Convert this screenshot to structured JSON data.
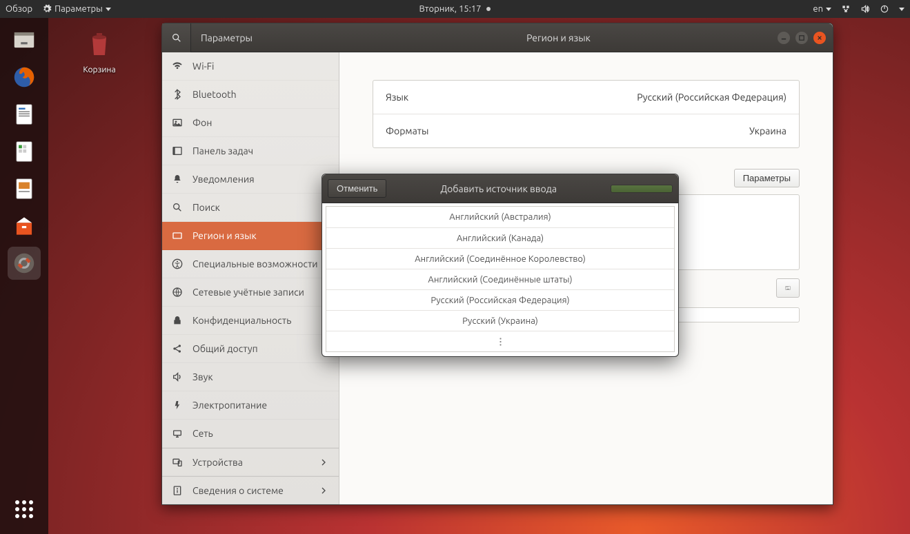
{
  "topbar": {
    "overview": "Обзор",
    "app_menu": "Параметры",
    "datetime": "Вторник, 15:17",
    "lang": "en"
  },
  "desktop": {
    "trash_label": "Корзина"
  },
  "dock": {
    "items": [
      "files",
      "firefox",
      "writer",
      "calc",
      "impress",
      "software",
      "settings"
    ]
  },
  "window": {
    "sidebar_title": "Параметры",
    "main_title": "Регион и язык"
  },
  "sidebar": {
    "items": [
      {
        "icon": "wifi",
        "label": "Wi-Fi"
      },
      {
        "icon": "bluetooth",
        "label": "Bluetooth"
      },
      {
        "icon": "background",
        "label": "Фон"
      },
      {
        "icon": "dock",
        "label": "Панель задач"
      },
      {
        "icon": "bell",
        "label": "Уведомления"
      },
      {
        "icon": "search",
        "label": "Поиск"
      },
      {
        "icon": "region",
        "label": "Регион и язык",
        "active": true
      },
      {
        "icon": "a11y",
        "label": "Специальные возможности"
      },
      {
        "icon": "accounts",
        "label": "Сетевые учётные записи"
      },
      {
        "icon": "privacy",
        "label": "Конфиденциальность"
      },
      {
        "icon": "share",
        "label": "Общий доступ"
      },
      {
        "icon": "sound",
        "label": "Звук"
      },
      {
        "icon": "power",
        "label": "Электропитание"
      },
      {
        "icon": "network",
        "label": "Сеть"
      },
      {
        "icon": "devices",
        "label": "Устройства",
        "chevron": true,
        "sep": true
      },
      {
        "icon": "info",
        "label": "Сведения о системе",
        "chevron": true,
        "sep": true
      }
    ]
  },
  "content": {
    "language_label": "Язык",
    "language_value": "Русский (Российская Федерация)",
    "formats_label": "Форматы",
    "formats_value": "Украина",
    "params_btn": "Параметры"
  },
  "modal": {
    "cancel": "Отменить",
    "title": "Добавить источник ввода",
    "items": [
      "Английский (Австралия)",
      "Английский (Канада)",
      "Английский (Соединённое Королевство)",
      "Английский (Соединённые штаты)",
      "Русский (Российская Федерация)",
      "Русский (Украина)"
    ]
  }
}
